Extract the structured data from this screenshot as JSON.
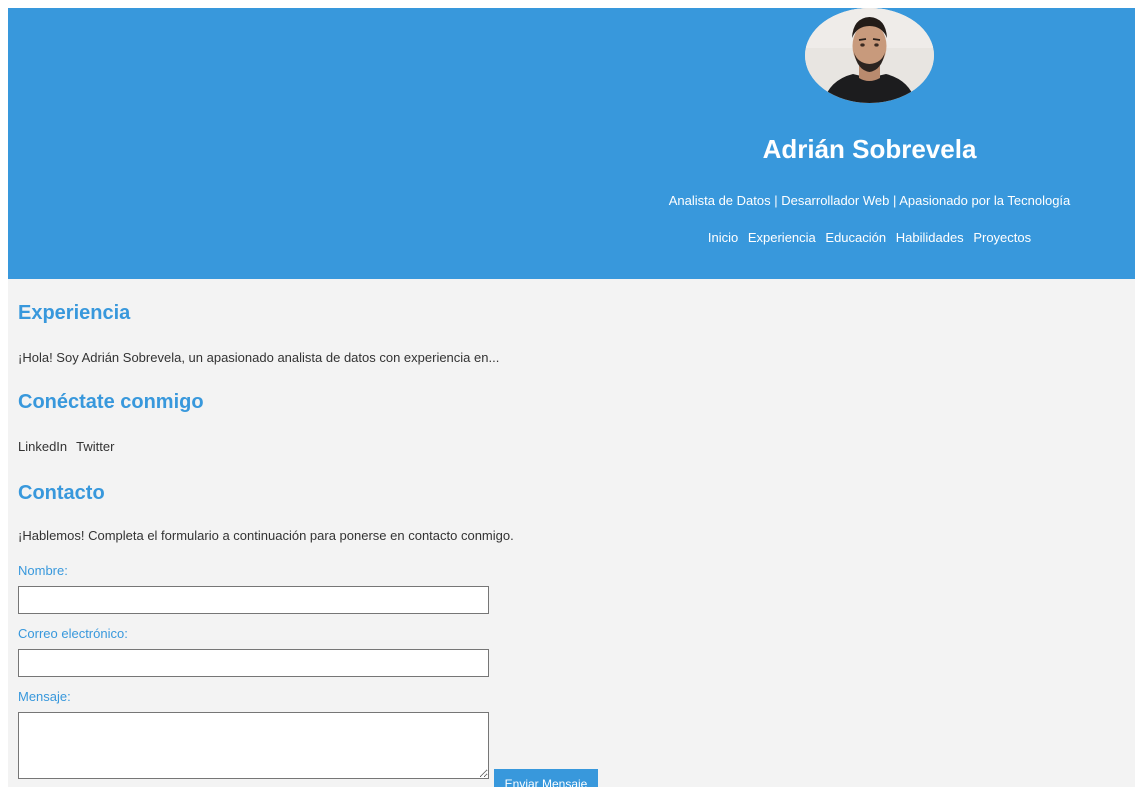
{
  "header": {
    "name": "Adrián Sobrevela",
    "tagline": "Analista de Datos | Desarrollador Web | Apasionado por la Tecnología",
    "nav": [
      "Inicio",
      "Experiencia",
      "Educación",
      "Habilidades",
      "Proyectos"
    ]
  },
  "experience": {
    "title": "Experiencia",
    "text": "¡Hola! Soy Adrián Sobrevela, un apasionado analista de datos con experiencia en..."
  },
  "connect": {
    "title": "Conéctate conmigo",
    "links": [
      "LinkedIn",
      "Twitter"
    ]
  },
  "contact": {
    "title": "Contacto",
    "text": "¡Hablemos! Completa el formulario a continuación para ponerse en contacto conmigo.",
    "name_label": "Nombre:",
    "email_label": "Correo electrónico:",
    "message_label": "Mensaje:",
    "name_value": "",
    "email_value": "",
    "message_value": "",
    "submit_label": "Enviar Mensaje"
  },
  "colors": {
    "accent": "#3898dc",
    "background": "#f3f3f3",
    "text": "#333333"
  }
}
